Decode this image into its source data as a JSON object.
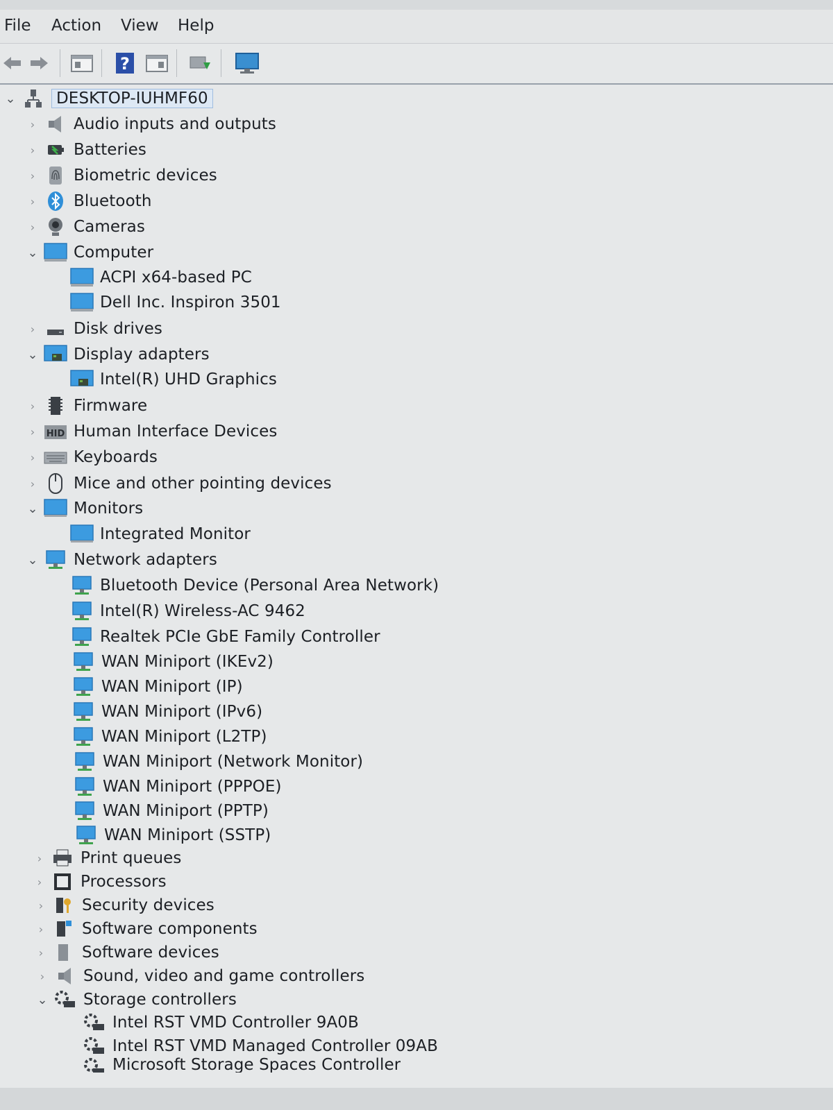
{
  "menu": {
    "file": "File",
    "action": "Action",
    "view": "View",
    "help": "Help"
  },
  "toolbar": {
    "icons": [
      "back-arrow-icon",
      "forward-arrow-icon",
      "properties-icon",
      "help-icon",
      "view-icon",
      "scan-hardware-icon",
      "monitor-icon"
    ]
  },
  "tree": {
    "root": "DESKTOP-IUHMF60",
    "categories": {
      "audio": "Audio inputs and outputs",
      "batteries": "Batteries",
      "biometric": "Biometric devices",
      "bluetooth": "Bluetooth",
      "cameras": "Cameras",
      "computer": "Computer",
      "computer_children": [
        "ACPI x64-based PC",
        "Dell Inc. Inspiron 3501"
      ],
      "disk": "Disk drives",
      "display": "Display adapters",
      "display_children": [
        "Intel(R) UHD Graphics"
      ],
      "firmware": "Firmware",
      "hid": "Human Interface Devices",
      "keyboards": "Keyboards",
      "mice": "Mice and other pointing devices",
      "monitors": "Monitors",
      "monitors_children": [
        "Integrated Monitor"
      ],
      "network": "Network adapters",
      "network_children": [
        "Bluetooth Device (Personal Area Network)",
        "Intel(R) Wireless-AC 9462",
        "Realtek PCIe GbE Family Controller",
        "WAN Miniport (IKEv2)",
        "WAN Miniport (IP)",
        "WAN Miniport (IPv6)",
        "WAN Miniport (L2TP)",
        "WAN Miniport (Network Monitor)",
        "WAN Miniport (PPPOE)",
        "WAN Miniport (PPTP)",
        "WAN Miniport (SSTP)"
      ],
      "print": "Print queues",
      "processors": "Processors",
      "security": "Security devices",
      "swcomponents": "Software components",
      "swdevices": "Software devices",
      "sound": "Sound, video and game controllers",
      "storage": "Storage controllers",
      "storage_children": [
        "Intel RST VMD Controller 9A0B",
        "Intel RST VMD Managed Controller 09AB",
        "Microsoft Storage Spaces Controller"
      ]
    }
  },
  "colors": {
    "accent_blue": "#2f8fd8",
    "selection_bg": "#dde8f4",
    "background": "#e6e8e9"
  }
}
